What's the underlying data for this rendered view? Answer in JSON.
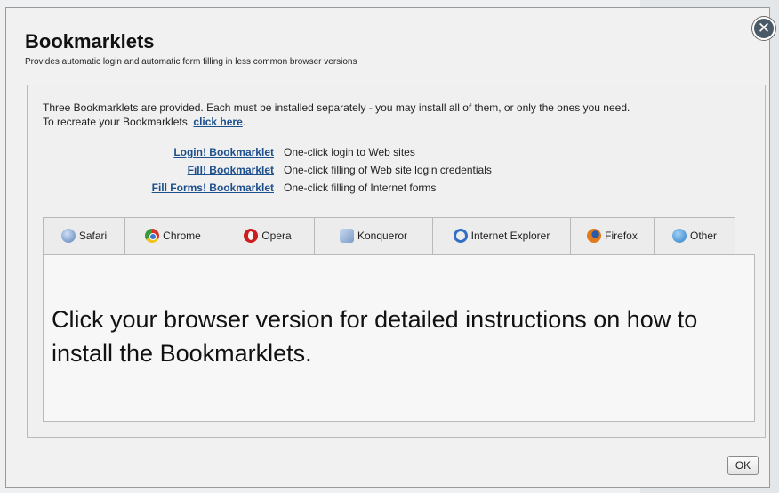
{
  "dialog": {
    "title": "Bookmarklets",
    "subtitle": "Provides automatic login and automatic form filling in less common browser versions",
    "close_icon": "close-icon"
  },
  "intro": {
    "line1": "Three Bookmarklets are provided. Each must be installed separately - you may install all of them, or only the ones you need.",
    "line2_prefix": "To recreate your Bookmarklets, ",
    "line2_link": "click here",
    "line2_suffix": "."
  },
  "bookmarklets": [
    {
      "link": "Login! Bookmarklet",
      "desc": "One-click login to Web sites"
    },
    {
      "link": "Fill! Bookmarklet",
      "desc": "One-click filling of Web site login credentials"
    },
    {
      "link": "Fill Forms! Bookmarklet",
      "desc": "One-click filling of Internet forms"
    }
  ],
  "tabs": [
    {
      "label": "Safari",
      "icon": "safari-icon",
      "color": "#5b7fb8"
    },
    {
      "label": "Chrome",
      "icon": "chrome-icon",
      "color": "#d8a21f"
    },
    {
      "label": "Opera",
      "icon": "opera-icon",
      "color": "#cc1e1e"
    },
    {
      "label": "Konqueror",
      "icon": "konqueror-icon",
      "color": "#7a9cc8"
    },
    {
      "label": "Internet Explorer",
      "icon": "internet-explorer-icon",
      "color": "#2f6fc4"
    },
    {
      "label": "Firefox",
      "icon": "firefox-icon",
      "color": "#e07a1c"
    },
    {
      "label": "Other",
      "icon": "globe-icon",
      "color": "#2e7fc8"
    }
  ],
  "content": {
    "message": "Click your browser version for detailed instructions on how to install the Bookmarklets."
  },
  "footer": {
    "ok_label": "OK"
  }
}
